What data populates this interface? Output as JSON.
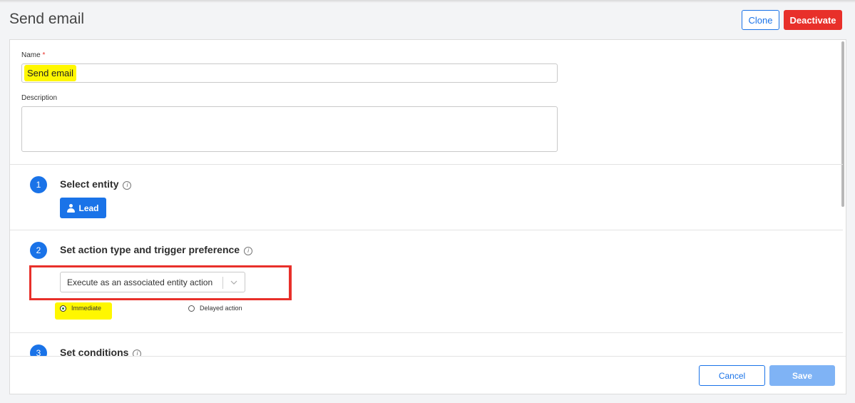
{
  "header": {
    "title": "Send email",
    "clone_label": "Clone",
    "deactivate_label": "Deactivate"
  },
  "form": {
    "name_label": "Name",
    "name_required_mark": "*",
    "name_value": "Send email",
    "description_label": "Description",
    "description_value": ""
  },
  "steps": [
    {
      "number": "1",
      "title": "Select entity",
      "info_icon": "info-icon"
    },
    {
      "number": "2",
      "title": "Set action type and trigger preference",
      "info_icon": "info-icon"
    },
    {
      "number": "3",
      "title": "Set conditions",
      "info_icon": "info-icon"
    }
  ],
  "entity": {
    "label": "Lead",
    "icon": "user-icon"
  },
  "action_type": {
    "selected": "Execute as an associated entity action",
    "options_visible": [
      "Immediate",
      "Delayed action"
    ],
    "selected_trigger": "Immediate"
  },
  "footer": {
    "cancel_label": "Cancel",
    "save_label": "Save"
  },
  "colors": {
    "primary": "#1a73e8",
    "danger": "#e8302a",
    "save_disabled": "#7fb3f5",
    "highlight": "#fff700"
  }
}
